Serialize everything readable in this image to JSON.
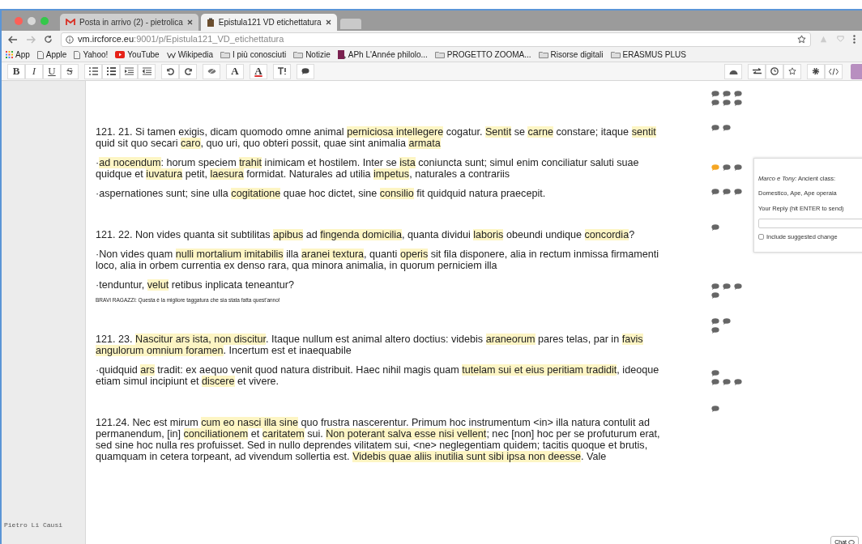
{
  "browser": {
    "tabs": [
      {
        "title": "Posta in arrivo (2) - pietrolica",
        "selected": false
      },
      {
        "title": "Epistula121 VD etichettatura",
        "selected": true
      }
    ],
    "url_host": "vm.ircforce.eu",
    "url_rest": ":9001/p/Epistula121_VD_etichettatura",
    "bookmarks": [
      {
        "label": "App",
        "kind": "apps"
      },
      {
        "label": "Apple",
        "kind": "page"
      },
      {
        "label": "Yahoo!",
        "kind": "page"
      },
      {
        "label": "YouTube",
        "kind": "youtube"
      },
      {
        "label": "Wikipedia",
        "kind": "wiki"
      },
      {
        "label": "I più conosciuti",
        "kind": "folder"
      },
      {
        "label": "Notizie",
        "kind": "folder"
      },
      {
        "label": "APh L'Année philolo...",
        "kind": "aph"
      },
      {
        "label": "PROGETTO ZOOMA...",
        "kind": "folder"
      },
      {
        "label": "Risorse digitali",
        "kind": "folder"
      },
      {
        "label": "ERASMUS PLUS",
        "kind": "folder"
      }
    ]
  },
  "toolbar": {
    "format_buttons": [
      {
        "label": "B",
        "kind": "bold"
      },
      {
        "label": "I",
        "kind": "italic"
      },
      {
        "label": "U",
        "kind": "underline"
      },
      {
        "label": "S",
        "kind": "strike"
      }
    ],
    "color_buttons": [
      {
        "label": "A",
        "kind": "font"
      },
      {
        "label": "A",
        "kind": "color"
      }
    ]
  },
  "sections": [
    {
      "paragraphs": [
        {
          "kind": "text",
          "segments": [
            {
              "text": "121. 21. Si tamen exigis, dicam quomodo omne animal ",
              "highlighted": false
            },
            {
              "text": "perniciosa intellegere",
              "highlighted": true
            },
            {
              "text": " cogatur. ",
              "highlighted": false
            },
            {
              "text": "Sentit",
              "highlighted": true
            },
            {
              "text": " se ",
              "highlighted": false
            },
            {
              "text": "carne",
              "highlighted": true
            },
            {
              "text": " constare; itaque ",
              "highlighted": false
            },
            {
              "text": "sentit",
              "highlighted": true
            },
            {
              "text": " quid sit quo secari ",
              "highlighted": false
            },
            {
              "text": "caro",
              "highlighted": true
            },
            {
              "text": ", quo uri, quo obteri possit, quae sint animalia ",
              "highlighted": false
            },
            {
              "text": "armata",
              "highlighted": true
            }
          ]
        },
        {
          "kind": "text",
          "segments": [
            {
              "text": "·",
              "highlighted": false
            },
            {
              "text": "ad nocendum",
              "highlighted": true
            },
            {
              "text": ": horum speciem ",
              "highlighted": false
            },
            {
              "text": "trahit",
              "highlighted": true
            },
            {
              "text": " inimicam et hostilem. Inter se ",
              "highlighted": false
            },
            {
              "text": "ista",
              "highlighted": true
            },
            {
              "text": " coniuncta sunt; simul enim conciliatur saluti suae quidque et ",
              "highlighted": false
            },
            {
              "text": "iuvatura",
              "highlighted": true
            },
            {
              "text": " petit, ",
              "highlighted": false
            },
            {
              "text": "laesura",
              "highlighted": true
            },
            {
              "text": " formidat. Naturales ad utilia ",
              "highlighted": false
            },
            {
              "text": "impetus",
              "highlighted": true
            },
            {
              "text": ", naturales a contrariis",
              "highlighted": false
            }
          ]
        },
        {
          "kind": "text",
          "segments": [
            {
              "text": "·aspernationes sunt; sine ulla ",
              "highlighted": false
            },
            {
              "text": "cogitatione",
              "highlighted": true
            },
            {
              "text": " quae hoc dictet, sine ",
              "highlighted": false
            },
            {
              "text": "consilio",
              "highlighted": true
            },
            {
              "text": " fit quidquid natura praecepit.",
              "highlighted": false
            }
          ]
        }
      ]
    },
    {
      "paragraphs": [
        {
          "kind": "text",
          "segments": [
            {
              "text": "121. 22. Non vides quanta sit subtilitas ",
              "highlighted": false
            },
            {
              "text": "apibus",
              "highlighted": true
            },
            {
              "text": " ad ",
              "highlighted": false
            },
            {
              "text": "fingenda domicilia",
              "highlighted": true
            },
            {
              "text": ", quanta dividui ",
              "highlighted": false
            },
            {
              "text": "laboris",
              "highlighted": true
            },
            {
              "text": " obeundi undique ",
              "highlighted": false
            },
            {
              "text": "concordia",
              "highlighted": true
            },
            {
              "text": "?",
              "highlighted": false
            }
          ]
        },
        {
          "kind": "text",
          "segments": [
            {
              "text": "·Non vides quam ",
              "highlighted": false
            },
            {
              "text": "nulli mortalium imitabilis",
              "highlighted": true
            },
            {
              "text": " illa ",
              "highlighted": false
            },
            {
              "text": "aranei textura",
              "highlighted": true
            },
            {
              "text": ", quanti ",
              "highlighted": false
            },
            {
              "text": "operis",
              "highlighted": true
            },
            {
              "text": " sit fila disponere, alia in rectum inmissa firmamenti loco, alia in orbem currentia ex denso rara, qua minora animalia, in quorum perniciem illa",
              "highlighted": false
            }
          ]
        },
        {
          "kind": "text",
          "segments": [
            {
              "text": "·tenduntur, ",
              "highlighted": false
            },
            {
              "text": "velut",
              "highlighted": true
            },
            {
              "text": " retibus inplicata teneantur?",
              "highlighted": false
            }
          ]
        },
        {
          "kind": "note",
          "segments": [
            {
              "text": "BRAVI RAGAZZI: Questa è la migliore taggatura che sia stata fatta quest'anno!",
              "highlighted": false
            }
          ]
        }
      ]
    },
    {
      "paragraphs": [
        {
          "kind": "text",
          "segments": [
            {
              "text": "121. 23. ",
              "highlighted": false
            },
            {
              "text": "Nascitur ars ista, non discitur",
              "highlighted": true
            },
            {
              "text": ". Itaque nullum est animal altero doctius: videbis ",
              "highlighted": false
            },
            {
              "text": "araneorum",
              "highlighted": true
            },
            {
              "text": " pares telas, par in ",
              "highlighted": false
            },
            {
              "text": "favis angulorum omnium foramen",
              "highlighted": true
            },
            {
              "text": ". Incertum est et inaequabile",
              "highlighted": false
            }
          ]
        },
        {
          "kind": "text",
          "segments": [
            {
              "text": "·quidquid ",
              "highlighted": false
            },
            {
              "text": "ars",
              "highlighted": true
            },
            {
              "text": " tradit: ex aequo venit quod natura distribuit. Haec nihil magis quam ",
              "highlighted": false
            },
            {
              "text": "tutelam sui et eius peritiam tradidit",
              "highlighted": true
            },
            {
              "text": ", ideoque etiam simul incipiunt et ",
              "highlighted": false
            },
            {
              "text": "discere",
              "highlighted": true
            },
            {
              "text": " et vivere.",
              "highlighted": false
            }
          ]
        }
      ]
    },
    {
      "paragraphs": [
        {
          "kind": "text",
          "segments": [
            {
              "text": "121.24. Nec est mirum ",
              "highlighted": false
            },
            {
              "text": "cum eo nasci illa sine",
              "highlighted": true
            },
            {
              "text": " quo frustra nascerentur. Primum hoc instrumentum <in> illa natura contulit ad permanendum, [in] ",
              "highlighted": false
            },
            {
              "text": "conciliationem",
              "highlighted": true
            },
            {
              "text": " et ",
              "highlighted": false
            },
            {
              "text": "caritatem",
              "highlighted": true
            },
            {
              "text": " sui. ",
              "highlighted": false
            },
            {
              "text": "Non poterant salva esse nisi vellent",
              "highlighted": true
            },
            {
              "text": "; nec [non] hoc per se profuturum erat, sed sine hoc nulla res profuisset. Sed in nullo deprendes vilitatem sui, <ne> neglegentiam quidem; tacitis quoque et brutis, quamquam in cetera torpeant, ad vivendum sollertia est. ",
              "highlighted": false
            },
            {
              "text": "Videbis quae aliis inutilia sunt sibi ipsa non deesse",
              "highlighted": true
            },
            {
              "text": ". Vale",
              "highlighted": false
            }
          ]
        }
      ]
    }
  ],
  "comment_markers": [
    {
      "icons": [
        {
          "active": false
        },
        {
          "active": false
        },
        {
          "active": false
        }
      ]
    },
    {
      "icons": [
        {
          "active": false
        },
        {
          "active": false
        },
        {
          "active": false
        }
      ]
    },
    {
      "icons": [
        {
          "active": false
        },
        {
          "active": false
        }
      ]
    },
    {
      "icons": [
        {
          "active": true
        },
        {
          "active": false
        },
        {
          "active": false
        }
      ]
    },
    {
      "icons": [
        {
          "active": false
        },
        {
          "active": false
        },
        {
          "active": false
        }
      ]
    },
    {
      "icons": [
        {
          "active": false
        }
      ]
    },
    {
      "icons": [
        {
          "active": false
        },
        {
          "active": false
        },
        {
          "active": false
        }
      ]
    },
    {
      "icons": [
        {
          "active": false
        }
      ]
    },
    {
      "icons": [
        {
          "active": false
        },
        {
          "active": false
        }
      ]
    },
    {
      "icons": [
        {
          "active": false
        }
      ]
    },
    {
      "icons": [
        {
          "active": false
        }
      ]
    },
    {
      "icons": [
        {
          "active": false
        },
        {
          "active": false
        },
        {
          "active": false
        }
      ]
    },
    {
      "icons": [
        {
          "active": false
        }
      ]
    }
  ],
  "comment_popup": {
    "comment": "*Marco e Tony:* Ancient class:",
    "detail": "Domestico, Ape, Ape operaia",
    "reply_label": "Your Reply (hit ENTER to send)",
    "checkbox_label": "Include suggested change",
    "checked": false
  },
  "sidebar": {
    "author": "Pietro Li Causi"
  },
  "chat_button": {
    "label": "Chat"
  }
}
